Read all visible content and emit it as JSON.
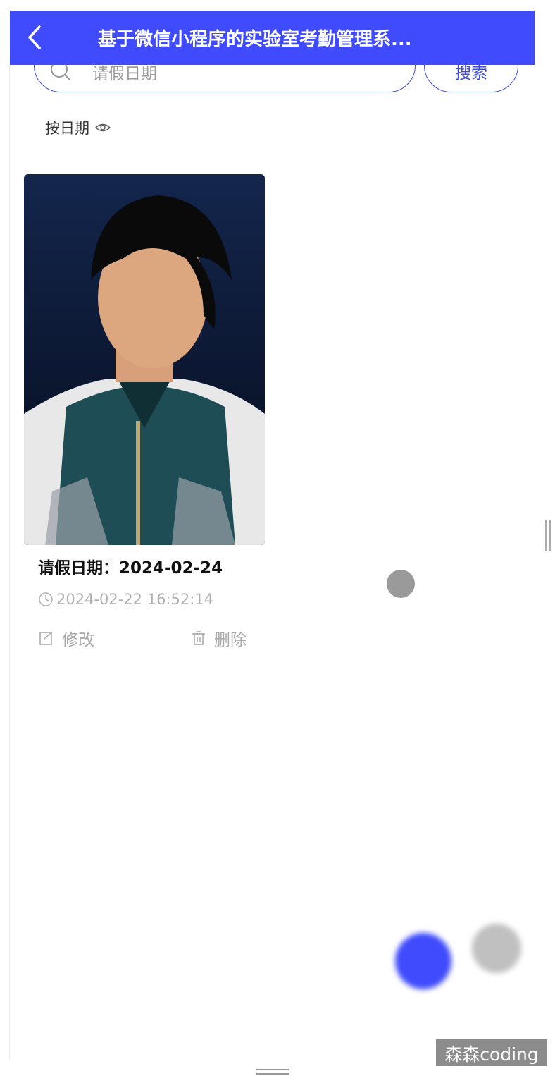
{
  "header": {
    "title": "基于微信小程序的实验室考勤管理系..."
  },
  "search": {
    "placeholder": "请假日期",
    "button_label": "搜索"
  },
  "sort": {
    "label": "按日期"
  },
  "cards": [
    {
      "title": "请假日期：2024-02-24",
      "timestamp": "2024-02-22 16:52:14",
      "edit_label": "修改",
      "delete_label": "删除"
    }
  ],
  "watermark": "森森coding",
  "colors": {
    "primary": "#3f4bfd",
    "muted": "#a8a8a8"
  },
  "icons": [
    "back-icon",
    "search-icon",
    "eye-icon",
    "clock-icon",
    "edit-icon",
    "trash-icon"
  ]
}
